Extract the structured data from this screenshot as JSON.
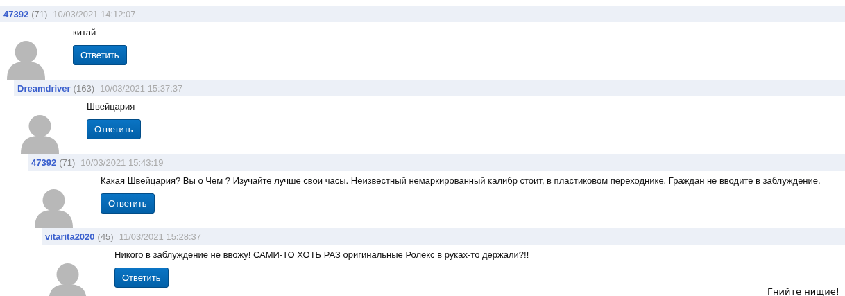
{
  "comments": [
    {
      "author": "47392",
      "rating": "(71)",
      "date": "10/03/2021 14:12:07",
      "text": "китай",
      "reply": "Ответить",
      "children": [
        {
          "author": "Dreamdriver",
          "rating": "(163)",
          "date": "10/03/2021 15:37:37",
          "text": "Швейцария",
          "reply": "Ответить",
          "children": [
            {
              "author": "47392",
              "rating": "(71)",
              "date": "10/03/2021 15:43:19",
              "text": "Какая Швейцария? Вы о Чем ? Изучайте лучше свои часы. Неизвестный немаркированный калибр стоит, в пластиковом переходнике. Граждан не вводите в заблуждение.",
              "reply": "Ответить",
              "children": [
                {
                  "author": "vitarita2020",
                  "rating": "(45)",
                  "date": "11/03/2021 15:28:37",
                  "text": "Никого в заблуждение не ввожу! САМИ-ТО ХОТЬ РАЗ оригинальные Ролекс в руках-то держали?!!",
                  "reply": "Ответить",
                  "note": "Гнийте нищие!"
                }
              ]
            }
          ]
        }
      ]
    }
  ]
}
